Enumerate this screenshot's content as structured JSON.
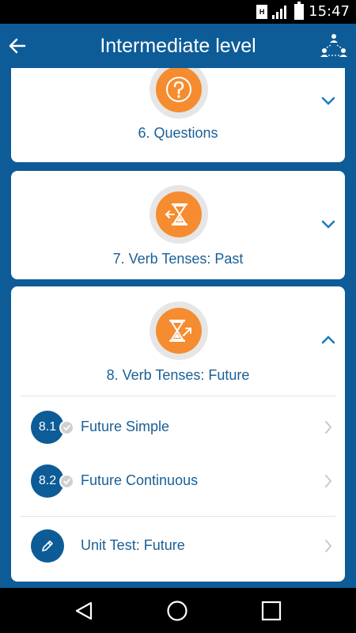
{
  "status_bar": {
    "time": "15:47",
    "sim_label": "H",
    "icons": [
      "sim-icon",
      "signal-icon",
      "battery-icon"
    ]
  },
  "app_bar": {
    "title": "Intermediate level",
    "back_icon": "arrow-left-icon",
    "people_icon": "people-network-icon"
  },
  "units": [
    {
      "title": "6. Questions",
      "icon": "question-mark-icon",
      "expanded": false
    },
    {
      "title": "7. Verb Tenses: Past",
      "icon": "hourglass-left-arrow-icon",
      "expanded": false
    },
    {
      "title": "8. Verb Tenses: Future",
      "icon": "hourglass-up-arrow-icon",
      "expanded": true,
      "lessons": [
        {
          "number": "8.1",
          "label": "Future Simple",
          "completed": true
        },
        {
          "number": "8.2",
          "label": "Future Continuous",
          "completed": true
        }
      ],
      "test": {
        "label": "Unit Test: Future",
        "icon": "pencil-icon"
      }
    }
  ],
  "colors": {
    "primary": "#0d5c98",
    "accent_orange": "#f58c2f",
    "badge_ring": "#e6e6e6",
    "card_bg": "#ffffff",
    "text_blue": "#1a5f96",
    "check_gray": "#cfcfcf"
  },
  "nav_bar": {
    "buttons": [
      "back-triangle-icon",
      "home-circle-icon",
      "recents-square-icon"
    ]
  }
}
